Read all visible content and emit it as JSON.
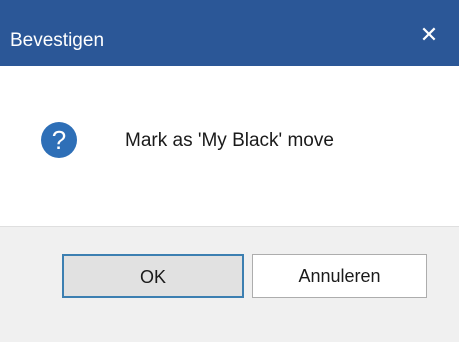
{
  "dialog": {
    "title": "Bevestigen",
    "close_label": "✕",
    "icon": "question-icon",
    "message": "Mark as 'My Black' move",
    "buttons": {
      "ok_label": "OK",
      "cancel_label": "Annuleren"
    },
    "colors": {
      "titlebar": "#2b5797",
      "icon": "#2e6fb7",
      "default_button_border": "#3c7fb1"
    }
  }
}
